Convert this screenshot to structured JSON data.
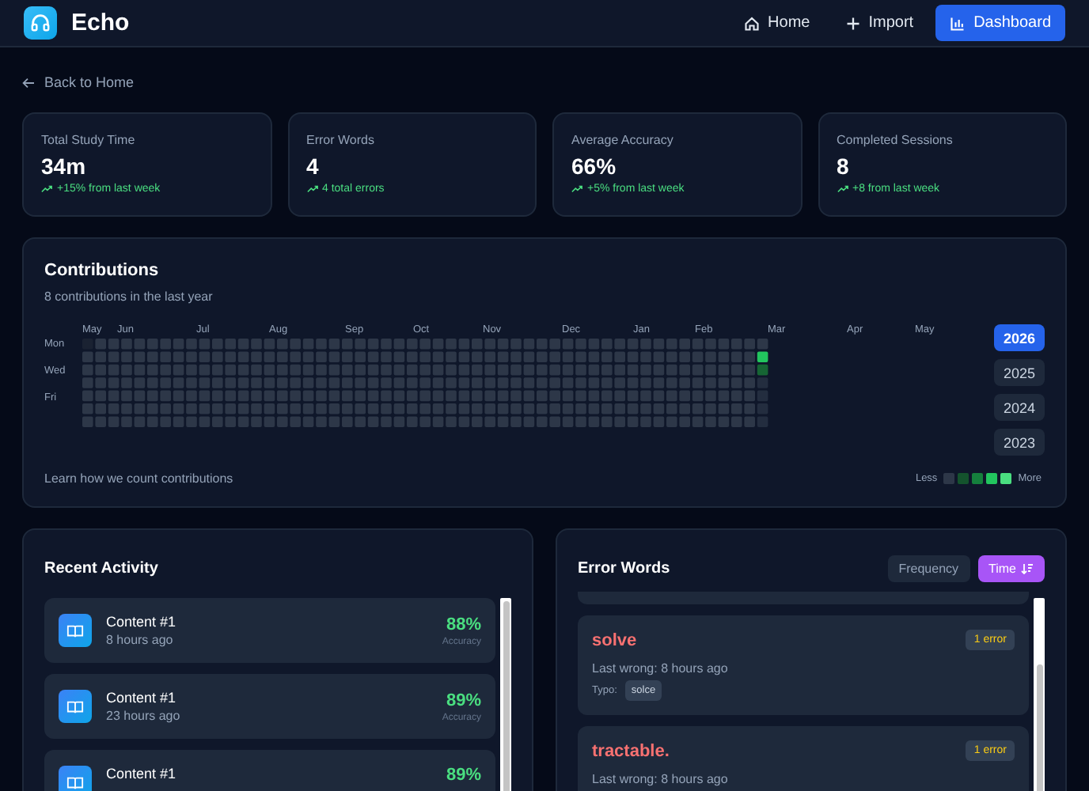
{
  "header": {
    "app_name": "Echo",
    "nav": [
      {
        "label": "Home",
        "selected": false
      },
      {
        "label": "Import",
        "selected": false
      },
      {
        "label": "Dashboard",
        "selected": true
      }
    ]
  },
  "back_link": "Back to Home",
  "stats": [
    {
      "label": "Total Study Time",
      "value": "34m",
      "trend": "+15% from last week"
    },
    {
      "label": "Error Words",
      "value": "4",
      "trend": "4 total errors"
    },
    {
      "label": "Average Accuracy",
      "value": "66%",
      "trend": "+5% from last week"
    },
    {
      "label": "Completed Sessions",
      "value": "8",
      "trend": "+8 from last week"
    }
  ],
  "contributions": {
    "title": "Contributions",
    "subtitle": "8 contributions in the last year",
    "months": [
      "May",
      "Jun",
      "Jul",
      "Aug",
      "Sep",
      "Oct",
      "Nov",
      "Dec",
      "Jan",
      "Feb",
      "Mar",
      "Apr",
      "May"
    ],
    "days": [
      "Mon",
      "Wed",
      "Fri"
    ],
    "latest_week": [
      {
        "color": "#2d3748"
      },
      {
        "color": "#22c55e"
      },
      {
        "color": "#166534"
      },
      {
        "color": "#232d3f"
      },
      {
        "color": "#232d3f"
      },
      {
        "color": "#232d3f"
      },
      {
        "color": "#232d3f"
      }
    ],
    "years": [
      {
        "label": "2026",
        "selected": true
      },
      {
        "label": "2025",
        "selected": false
      },
      {
        "label": "2024",
        "selected": false
      },
      {
        "label": "2023",
        "selected": false
      }
    ],
    "footer_link": "Learn how we count contributions",
    "legend": {
      "less": "Less",
      "more": "More",
      "swatches": [
        {
          "color": "#2d3748"
        },
        {
          "color": "#14532d"
        },
        {
          "color": "#15803d"
        },
        {
          "color": "#22c55e"
        },
        {
          "color": "#4ade80"
        }
      ]
    }
  },
  "recent_activity": {
    "title": "Recent Activity",
    "items": [
      {
        "title": "Content #1",
        "time": "8 hours ago",
        "accuracy": "88%",
        "accuracy_label": "Accuracy"
      },
      {
        "title": "Content #1",
        "time": "23 hours ago",
        "accuracy": "89%",
        "accuracy_label": "Accuracy"
      },
      {
        "title": "Content #1",
        "accuracy": "89%"
      }
    ]
  },
  "error_words": {
    "title": "Error Words",
    "sort": [
      {
        "label": "Frequency",
        "selected": false
      },
      {
        "label": "Time",
        "selected": true
      }
    ],
    "items": [
      {
        "word": "solve",
        "count": "1 error",
        "last_wrong": "Last wrong: 8 hours ago",
        "typo_label": "Typo:",
        "typos": [
          "solce"
        ]
      },
      {
        "word": "tractable.",
        "count": "1 error",
        "last_wrong": "Last wrong: 8 hours ago"
      }
    ]
  }
}
